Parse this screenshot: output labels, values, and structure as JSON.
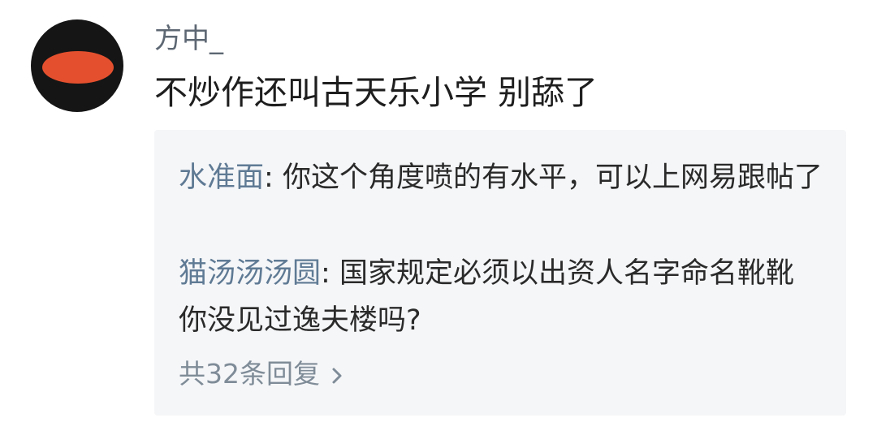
{
  "comment": {
    "username": "方中_",
    "text": "不炒作还叫古天乐小学 别舔了",
    "avatar_icon": "avatar-icon",
    "avatar_colors": {
      "ring": "#151515",
      "fill": "#e4502e"
    }
  },
  "replies": [
    {
      "author": "水准面",
      "text": "你这个角度喷的有水平，可以上网易跟帖了"
    },
    {
      "author": "猫汤汤汤圆",
      "text": "国家规定必须以出资人名字命名靴靴 你没见过逸夫楼吗?"
    }
  ],
  "view_all": {
    "label": "共32条回复",
    "icon": "chevron-right-icon"
  },
  "colors": {
    "username": "#5d6773",
    "comment_text": "#1e1e1e",
    "reply_author": "#5f7a94",
    "reply_text": "#2a2a2a",
    "reply_box_bg": "#f5f6f8",
    "view_all": "#7f8c98"
  }
}
